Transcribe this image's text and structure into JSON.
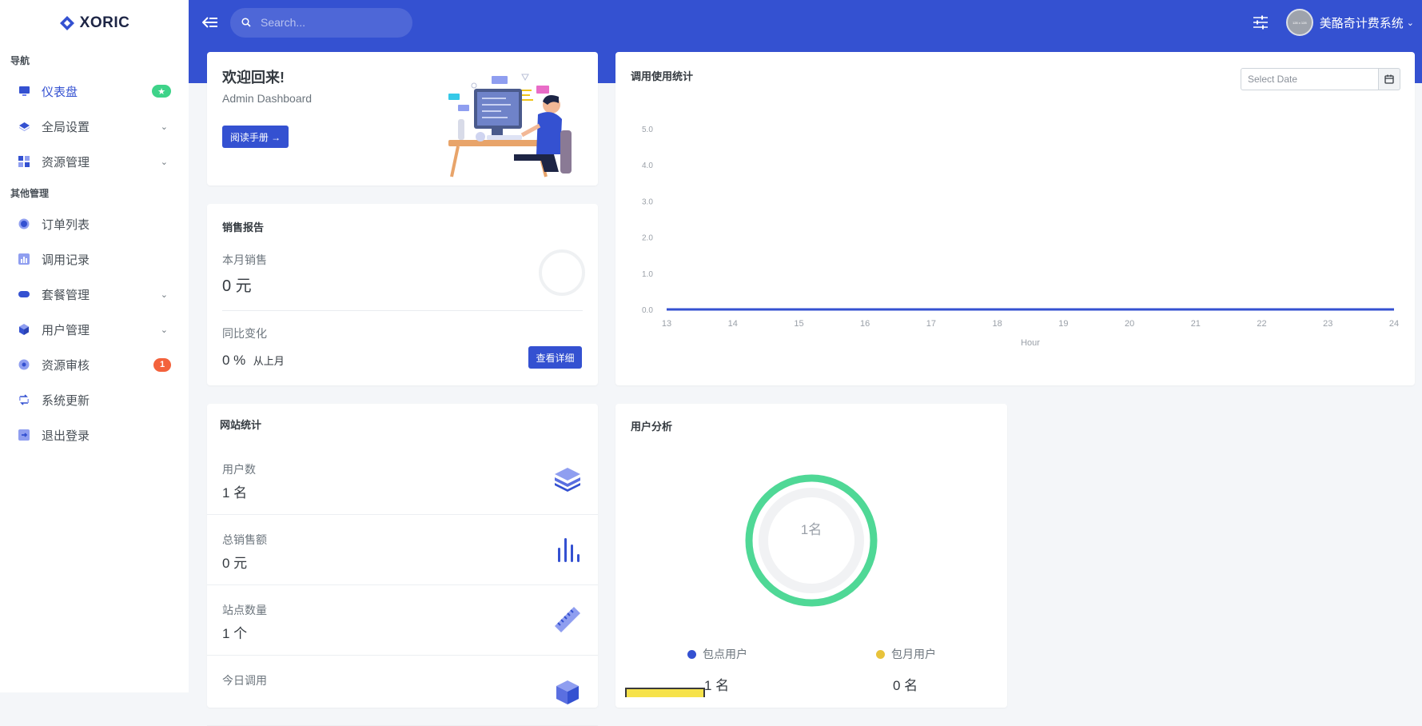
{
  "app": {
    "logo": "XORIC"
  },
  "sidebar": {
    "section_nav": "导航",
    "section_other": "其他管理",
    "items": [
      {
        "label": "仪表盘",
        "icon": "monitor-icon",
        "badge": "★"
      },
      {
        "label": "全局设置",
        "icon": "layers-icon"
      },
      {
        "label": "资源管理",
        "icon": "grid-icon"
      },
      {
        "label": "订单列表",
        "icon": "circle-icon"
      },
      {
        "label": "调用记录",
        "icon": "bar-chart-icon"
      },
      {
        "label": "套餐管理",
        "icon": "toggle-icon"
      },
      {
        "label": "用户管理",
        "icon": "cube-icon"
      },
      {
        "label": "资源审核",
        "icon": "chat-icon",
        "badge": "1"
      },
      {
        "label": "系统更新",
        "icon": "refresh-icon"
      },
      {
        "label": "退出登录",
        "icon": "logout-icon"
      }
    ]
  },
  "header": {
    "search_placeholder": "Search...",
    "avatar_text": "128 x 128",
    "user_name": "美酪奇计费系统"
  },
  "welcome": {
    "title": "欢迎回来!",
    "subtitle": "Admin Dashboard",
    "button": "阅读手册 →"
  },
  "sales": {
    "title": "销售报告",
    "month_label": "本月销售",
    "month_value": "0 元",
    "change_label": "同比变化",
    "change_value": "0 %",
    "change_suffix": "从上月",
    "button": "查看详细"
  },
  "site_stats": {
    "title": "网站统计",
    "rows": [
      {
        "label": "用户数",
        "value": "1 名",
        "icon": "layers-stack-icon"
      },
      {
        "label": "总销售额",
        "value": "0 元",
        "icon": "bar-chart-icon"
      },
      {
        "label": "站点数量",
        "value": "1 个",
        "icon": "ruler-icon"
      },
      {
        "label": "今日调用",
        "value": "",
        "icon": "cube-icon"
      }
    ]
  },
  "usage": {
    "title": "调用使用统计",
    "date_placeholder": "Select Date"
  },
  "chart_data": {
    "type": "line",
    "title": "",
    "xlabel": "Hour",
    "ylabel": "",
    "x": [
      13,
      14,
      15,
      16,
      17,
      18,
      19,
      20,
      21,
      22,
      23,
      24
    ],
    "series": [
      {
        "values": [
          0,
          0,
          0,
          0,
          0,
          0,
          0,
          0,
          0,
          0,
          0,
          0
        ]
      }
    ],
    "ylim": [
      0,
      5
    ],
    "yticks": [
      "0.0",
      "1.0",
      "2.0",
      "3.0",
      "4.0",
      "5.0"
    ],
    "grid": false,
    "color": "#3451d1"
  },
  "users_analysis": {
    "title": "用户分析",
    "center_label": "1名",
    "legend": [
      {
        "name": "包点用户",
        "value": "1 名",
        "color": "#3451d1"
      },
      {
        "name": "包月用户",
        "value": "0 名",
        "color": "#e8c33b"
      }
    ],
    "ring_color": "#4fd896"
  }
}
